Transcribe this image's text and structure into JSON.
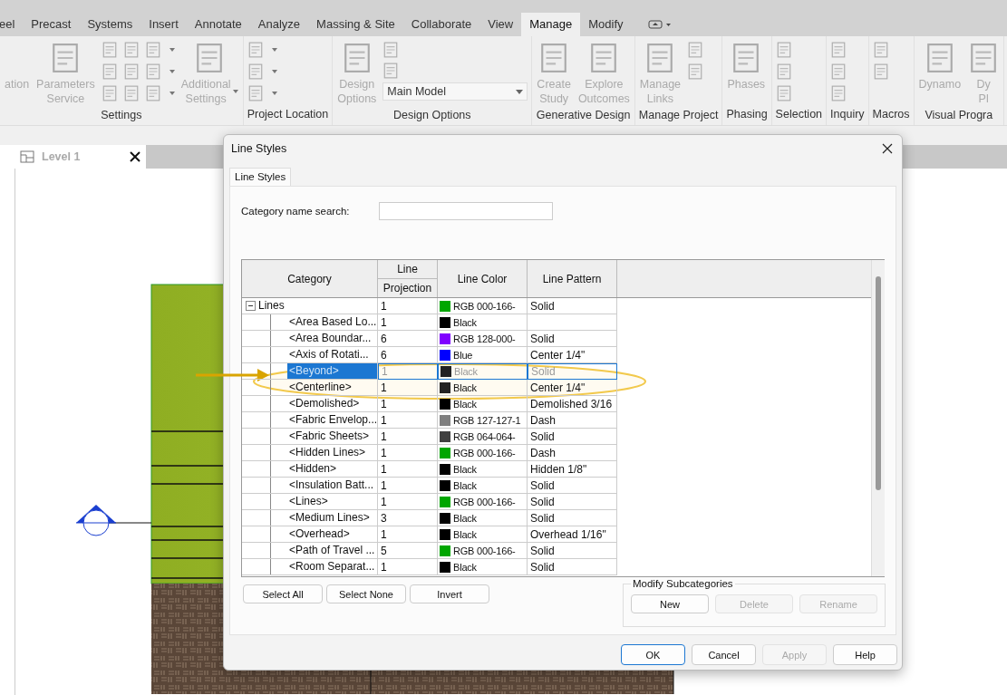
{
  "ribbon_tabs": [
    {
      "label": "eel",
      "selected": false
    },
    {
      "label": "Precast",
      "selected": false
    },
    {
      "label": "Systems",
      "selected": false
    },
    {
      "label": "Insert",
      "selected": false
    },
    {
      "label": "Annotate",
      "selected": false
    },
    {
      "label": "Analyze",
      "selected": false
    },
    {
      "label": "Massing & Site",
      "selected": false
    },
    {
      "label": "Collaborate",
      "selected": false
    },
    {
      "label": "View",
      "selected": false
    },
    {
      "label": "Manage",
      "selected": true
    },
    {
      "label": "Modify",
      "selected": false
    }
  ],
  "ribbon_panels": [
    {
      "label": "Settings",
      "items": [
        {
          "kind": "text",
          "lines": [
            "ation"
          ]
        },
        {
          "kind": "large",
          "lines": [
            "Parameters",
            "Service"
          ]
        },
        {
          "kind": "grid"
        },
        {
          "kind": "stack",
          "caret": true
        },
        {
          "kind": "large",
          "lines": [
            "Additional",
            "Settings"
          ],
          "caret": true
        }
      ]
    },
    {
      "label": "Project Location",
      "items": [
        {
          "kind": "stack",
          "caret": true
        }
      ]
    },
    {
      "label": "Design Options",
      "items": [
        {
          "kind": "large",
          "lines": [
            "Design",
            "Options"
          ]
        },
        {
          "kind": "combo",
          "value": "Main Model"
        }
      ]
    },
    {
      "label": "Generative Design",
      "items": [
        {
          "kind": "large",
          "lines": [
            "Create",
            "Study"
          ]
        },
        {
          "kind": "large",
          "lines": [
            "Explore",
            "Outcomes"
          ]
        }
      ]
    },
    {
      "label": "Manage Project",
      "items": [
        {
          "kind": "large",
          "lines": [
            "Manage",
            "Links"
          ]
        },
        {
          "kind": "pair"
        }
      ]
    },
    {
      "label": "Phasing",
      "items": [
        {
          "kind": "large",
          "lines": [
            "Phases"
          ]
        }
      ]
    },
    {
      "label": "Selection",
      "items": [
        {
          "kind": "stack",
          "caret": false
        }
      ]
    },
    {
      "label": "Inquiry",
      "items": [
        {
          "kind": "stack",
          "caret": false
        }
      ]
    },
    {
      "label": "Macros",
      "items": [
        {
          "kind": "pair"
        }
      ]
    },
    {
      "label": "Visual Progra",
      "items": [
        {
          "kind": "large",
          "lines": [
            "Dynamo"
          ]
        },
        {
          "kind": "large",
          "lines": [
            "Dy",
            "Pl"
          ]
        }
      ]
    }
  ],
  "view_tab": {
    "title": "Level 1"
  },
  "dialog": {
    "title": "Line Styles",
    "tab": "Line Styles",
    "search_label": "Category name search:",
    "columns": {
      "category": "Category",
      "group": "Line",
      "projection": "Projection",
      "line_color": "Line Color",
      "line_pattern": "Line Pattern"
    },
    "rows": [
      {
        "name": "Lines",
        "weight": "1",
        "color": "#00a600",
        "color_label": "RGB 000-166-",
        "pattern": "Solid",
        "expanded": true,
        "selected": false,
        "children": [
          {
            "name": "<Area Based Lo...",
            "weight": "1",
            "color": "#000000",
            "color_label": "Black",
            "selected": false
          },
          {
            "name": "<Area Boundar...",
            "weight": "6",
            "color": "#8000ff",
            "color_label": "RGB 128-000-",
            "pattern": "Solid",
            "selected": false
          },
          {
            "name": "<Axis of Rotati...",
            "weight": "6",
            "color": "#0000ff",
            "color_label": "Blue",
            "pattern": "Center 1/4\"",
            "selected": false
          },
          {
            "name": "<Beyond>",
            "weight": "1",
            "color": "#222222",
            "color_label": "Black",
            "pattern": "Solid",
            "selected": true
          },
          {
            "name": "<Centerline>",
            "weight": "1",
            "color": "#222222",
            "color_label": "Black",
            "pattern": "Center 1/4\"",
            "selected": false
          },
          {
            "name": "<Demolished>",
            "weight": "1",
            "color": "#000000",
            "color_label": "Black",
            "pattern": "Demolished 3/16",
            "selected": false
          },
          {
            "name": "<Fabric Envelop...",
            "weight": "1",
            "color": "#7f7f7f",
            "color_label": "RGB 127-127-1",
            "pattern": "Dash",
            "selected": false
          },
          {
            "name": "<Fabric Sheets>",
            "weight": "1",
            "color": "#404040",
            "color_label": "RGB 064-064-",
            "pattern": "Solid",
            "selected": false
          },
          {
            "name": "<Hidden Lines>",
            "weight": "1",
            "color": "#00a600",
            "color_label": "RGB 000-166-",
            "pattern": "Dash",
            "selected": false
          },
          {
            "name": "<Hidden>",
            "weight": "1",
            "color": "#000000",
            "color_label": "Black",
            "pattern": "Hidden 1/8\"",
            "selected": false
          },
          {
            "name": "<Insulation Batt...",
            "weight": "1",
            "color": "#000000",
            "color_label": "Black",
            "pattern": "Solid",
            "selected": false
          },
          {
            "name": "<Lines>",
            "weight": "1",
            "color": "#00a600",
            "color_label": "RGB 000-166-",
            "pattern": "Solid",
            "selected": false
          },
          {
            "name": "<Medium Lines>",
            "weight": "3",
            "color": "#000000",
            "color_label": "Black",
            "pattern": "Solid",
            "selected": false
          },
          {
            "name": "<Overhead>",
            "weight": "1",
            "color": "#000000",
            "color_label": "Black",
            "pattern": "Overhead 1/16\"",
            "selected": false
          },
          {
            "name": "<Path of Travel ...",
            "weight": "5",
            "color": "#00a600",
            "color_label": "RGB 000-166-",
            "pattern": "Solid",
            "selected": false
          },
          {
            "name": "<Room Separat...",
            "weight": "1",
            "color": "#000000",
            "color_label": "Black",
            "pattern": "Solid",
            "selected": false
          }
        ]
      }
    ],
    "list_buttons": [
      {
        "label": "Select All",
        "disabled": false
      },
      {
        "label": "Select None",
        "disabled": false
      },
      {
        "label": "Invert",
        "disabled": false
      }
    ],
    "subcategories": {
      "title": "Modify Subcategories",
      "buttons": [
        {
          "label": "New",
          "disabled": false
        },
        {
          "label": "Delete",
          "disabled": true
        },
        {
          "label": "Rename",
          "disabled": true
        }
      ]
    },
    "footer_buttons": [
      {
        "label": "OK",
        "disabled": false,
        "default": true
      },
      {
        "label": "Cancel",
        "disabled": false,
        "default": false
      },
      {
        "label": "Apply",
        "disabled": true,
        "default": false
      },
      {
        "label": "Help",
        "disabled": false,
        "default": false
      }
    ]
  }
}
